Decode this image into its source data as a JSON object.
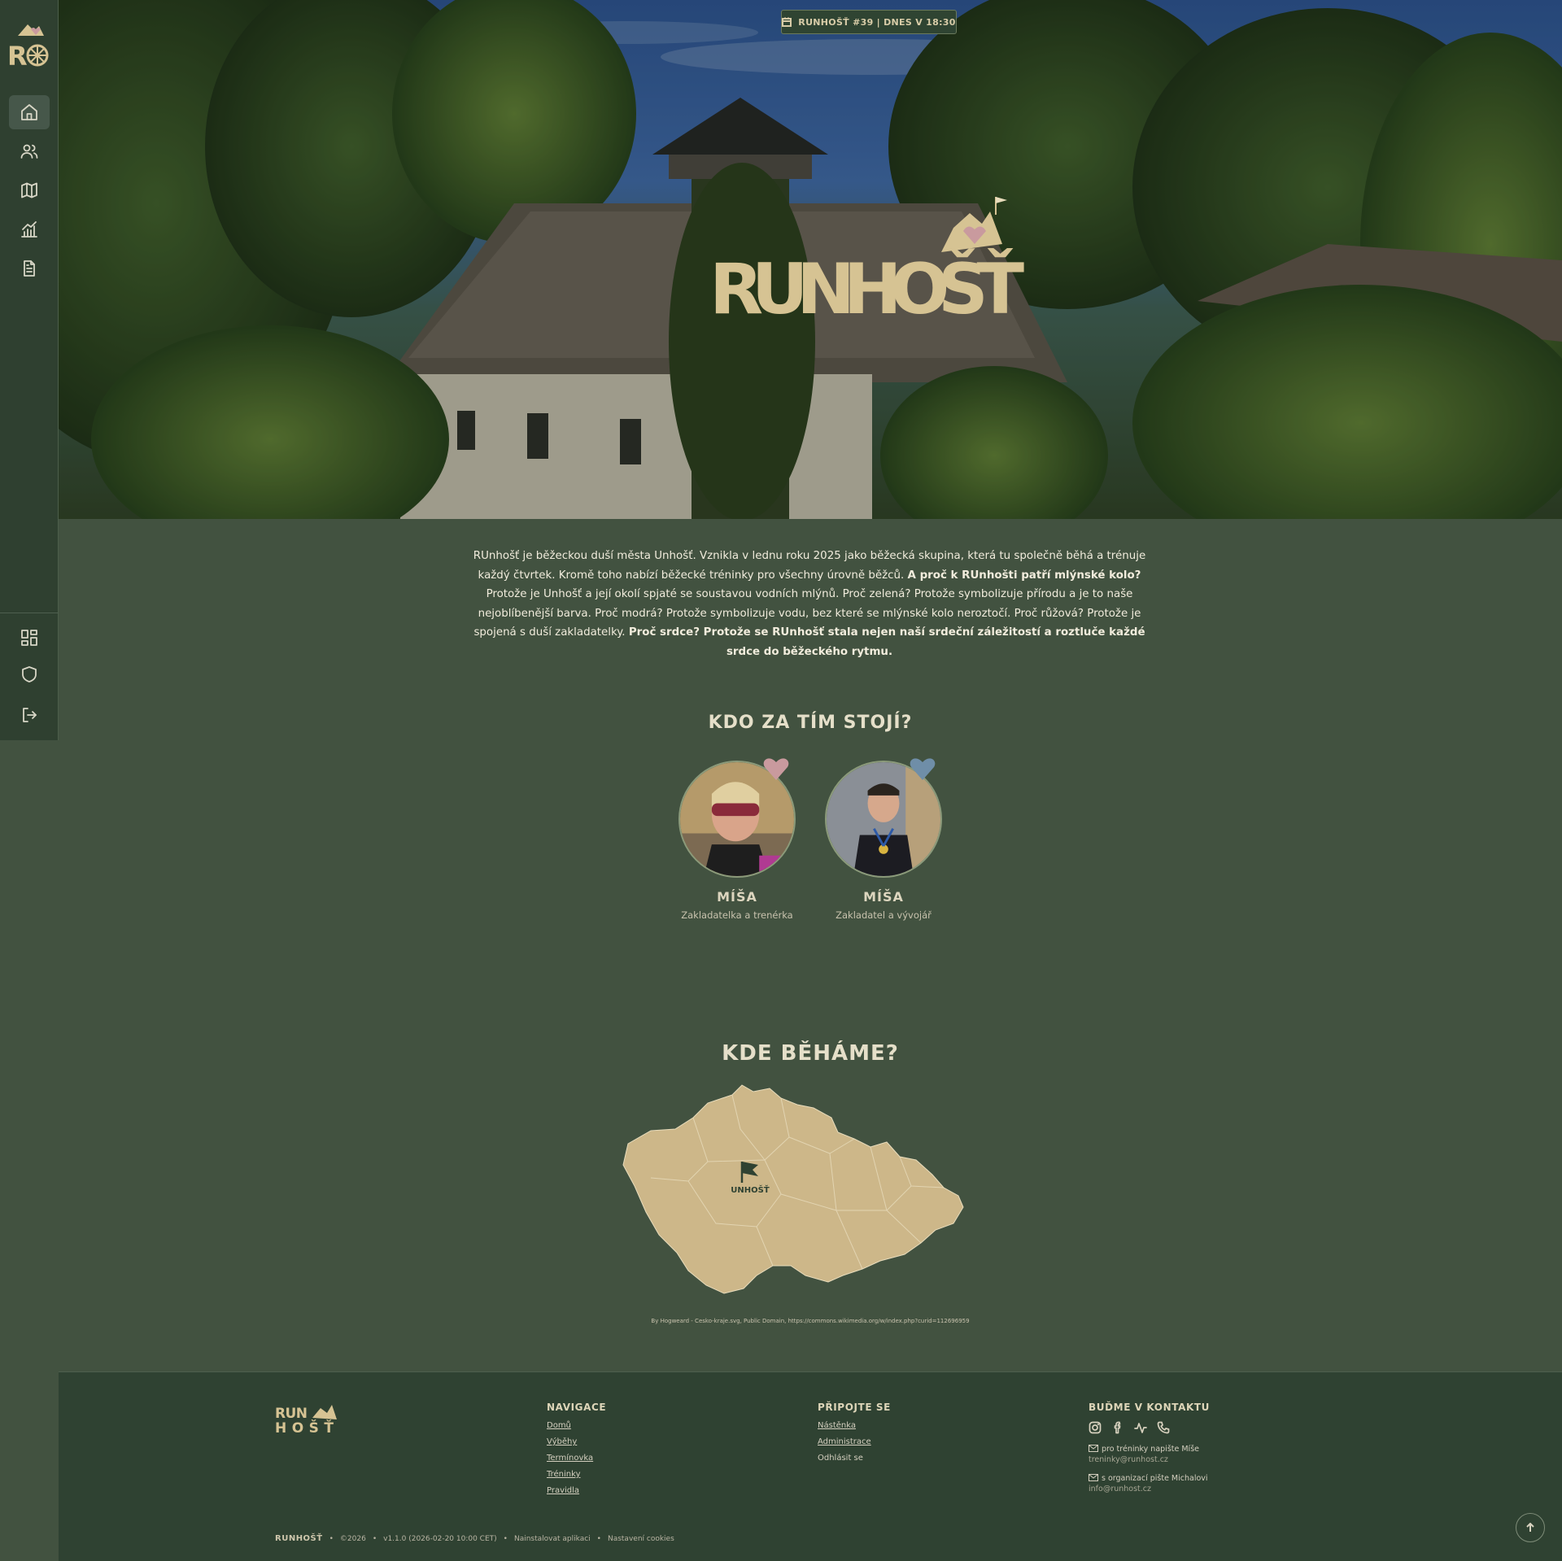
{
  "colors": {
    "bg": "#425240",
    "sidebar": "#2f4030",
    "footer": "#2f4232",
    "accent": "#d6c393",
    "heart_pink": "#c99a9e",
    "heart_blue": "#6f8ea8"
  },
  "hero": {
    "badge_text": "RUNHOŠŤ #39 | DNES V 18:30",
    "logo_text": "RUNHOŠŤ"
  },
  "intro": {
    "p1": "RUnhošť je běžeckou duší města Unhošť. Vznikla v lednu roku 2025 jako běžecká skupina, která tu společně běhá a trénuje každý čtvrtek. Kromě toho nabízí běžecké tréninky pro všechny úrovně běžců. ",
    "b1": "A proč k RUnhošti patří mlýnské kolo?",
    "p2": " Protože je Unhošť a její okolí spjaté se soustavou vodních mlýnů. Proč zelená? Protože symbolizuje přírodu a je to naše nejoblíbenější barva. Proč modrá? Protože symbolizuje vodu, bez které se mlýnské kolo neroztočí. Proč růžová? Protože je spojená s duší zakladatelky. ",
    "b2": "Proč srdce? Protože se RUnhošť stala nejen naší srdeční záležitostí a roztluče každé srdce do běžeckého rytmu."
  },
  "team": {
    "title": "KDO ZA TÍM STOJÍ?",
    "members": [
      {
        "name": "MÍŠA",
        "role": "Zakladatelka a trenérka"
      },
      {
        "name": "MÍŠA",
        "role": "Zakladatel a vývojář"
      }
    ]
  },
  "map": {
    "title": "KDE BĚHÁME?",
    "marker_label": "UNHOŠŤ",
    "credit": "By Hogweard - Cesko-kraje.svg, Public Domain, https://commons.wikimedia.org/w/index.php?curid=112696959"
  },
  "footer": {
    "logo_text": "RUNHOŠŤ",
    "nav_title": "NAVIGACE",
    "nav_links": [
      "Domů",
      "Výběhy",
      "Termínovka",
      "Tréninky",
      "Pravidla"
    ],
    "join_title": "PŘIPOJTE SE",
    "join_links": [
      "Nástěnka",
      "Administrace"
    ],
    "logout": "Odhlásit se",
    "contact_title": "BUĎME V KONTAKTU",
    "contacts": [
      {
        "label": "pro tréninky napište Míše",
        "email": "treninky@runhost.cz"
      },
      {
        "label": "s organizací pište Michalovi",
        "email": "info@runhost.cz"
      }
    ],
    "brand": "RUNHOŠŤ",
    "copyright": "©2026",
    "version": "v1.1.0 (2026-02-20 10:00 CET)",
    "install": "Nainstalovat aplikaci",
    "cookies": "Nastavení cookies",
    "sep": "•"
  },
  "icons": {
    "sidebar": [
      "home-icon",
      "users-icon",
      "map-icon",
      "chart-icon",
      "document-icon",
      "dashboard-icon",
      "shield-icon",
      "logout-icon"
    ],
    "social": [
      "instagram-icon",
      "facebook-icon",
      "activity-icon",
      "phone-icon"
    ]
  }
}
